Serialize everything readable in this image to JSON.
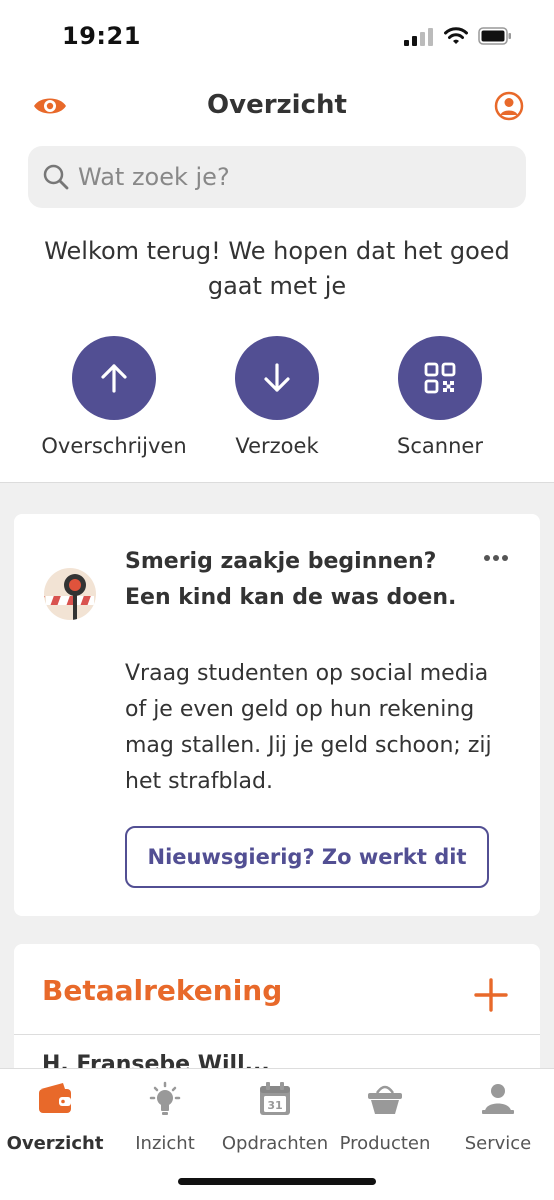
{
  "status_bar": {
    "time": "19:21"
  },
  "header": {
    "title": "Overzicht"
  },
  "search": {
    "placeholder": "Wat zoek je?"
  },
  "welcome": {
    "text": "Welkom terug! We hopen dat het goed gaat met je"
  },
  "actions": [
    {
      "label": "Overschrijven",
      "icon": "arrow-up-icon"
    },
    {
      "label": "Verzoek",
      "icon": "arrow-down-icon"
    },
    {
      "label": "Scanner",
      "icon": "qr-code-icon"
    }
  ],
  "promo_card": {
    "title": "Smerig zaakje beginnen? Een kind kan de was doen.",
    "body": "Vraag studenten op social media of je even geld op hun rekening mag stallen. Jij je geld schoon; zij het strafblad.",
    "button": "Nieuwsgierig? Zo werkt dit"
  },
  "account_card": {
    "title": "Betaalrekening",
    "partial_text": "H. Fransebe Will..."
  },
  "tabs": [
    {
      "label": "Overzicht",
      "icon": "wallet-icon",
      "active": true
    },
    {
      "label": "Inzicht",
      "icon": "lightbulb-icon",
      "active": false
    },
    {
      "label": "Opdrachten",
      "icon": "calendar-icon",
      "active": false
    },
    {
      "label": "Producten",
      "icon": "basket-icon",
      "active": false
    },
    {
      "label": "Service",
      "icon": "person-service-icon",
      "active": false
    }
  ],
  "colors": {
    "brand_orange": "#E8692A",
    "accent_purple": "#524F93",
    "background_grey": "#F0F0F0"
  }
}
